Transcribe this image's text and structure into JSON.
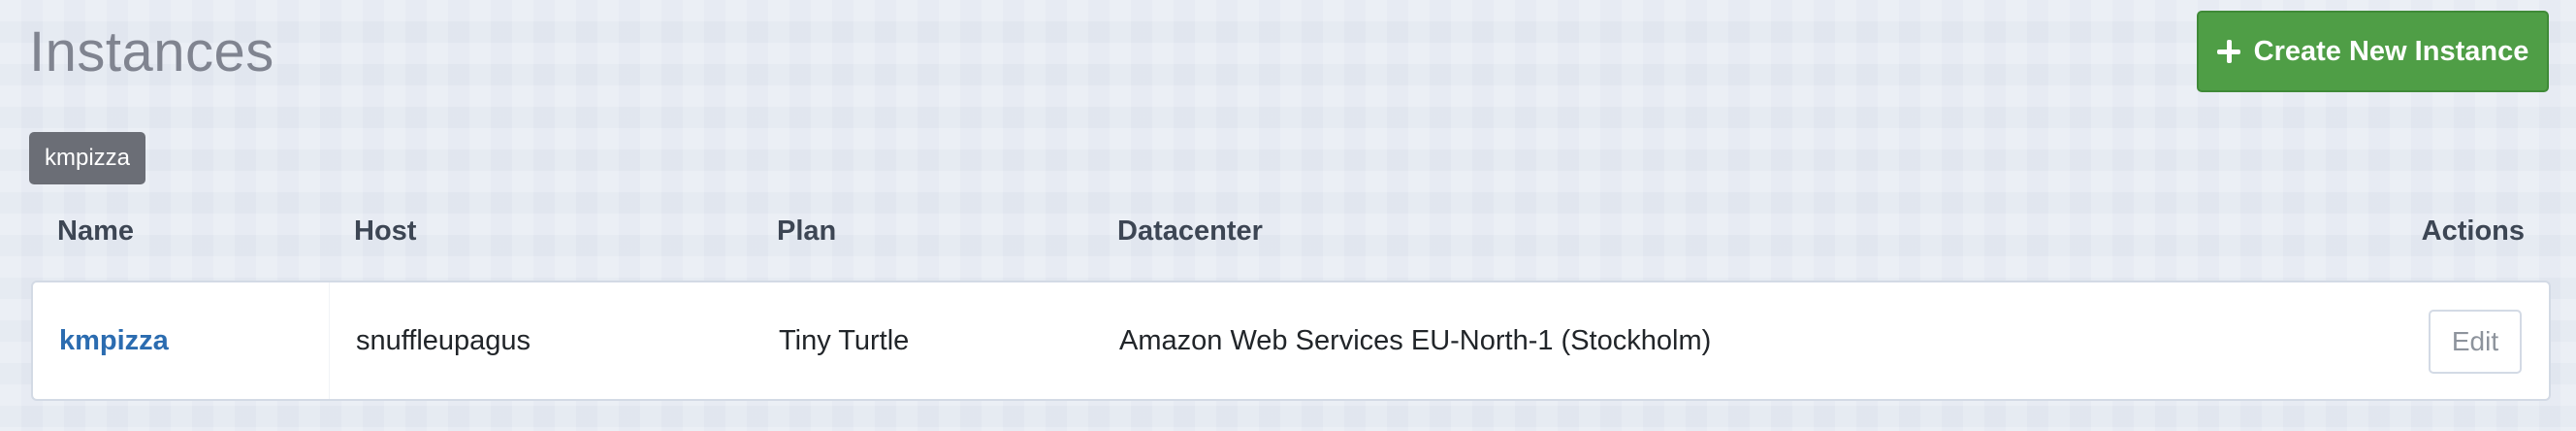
{
  "header": {
    "title": "Instances",
    "create_button_label": "Create New Instance",
    "create_button_icon": "plus-icon"
  },
  "filter": {
    "active_tag": "kmpizza"
  },
  "table": {
    "columns": [
      "Name",
      "Host",
      "Plan",
      "Datacenter",
      "Actions"
    ],
    "rows": [
      {
        "name": "kmpizza",
        "host": "snuffleupagus",
        "plan": "Tiny Turtle",
        "datacenter": "Amazon Web Services EU-North-1 (Stockholm)",
        "action_label": "Edit"
      }
    ]
  },
  "colors": {
    "accent_green": "#4f9e46",
    "link_blue": "#2b6cb0",
    "badge_gray": "#6b6e76",
    "title_gray": "#808490"
  }
}
